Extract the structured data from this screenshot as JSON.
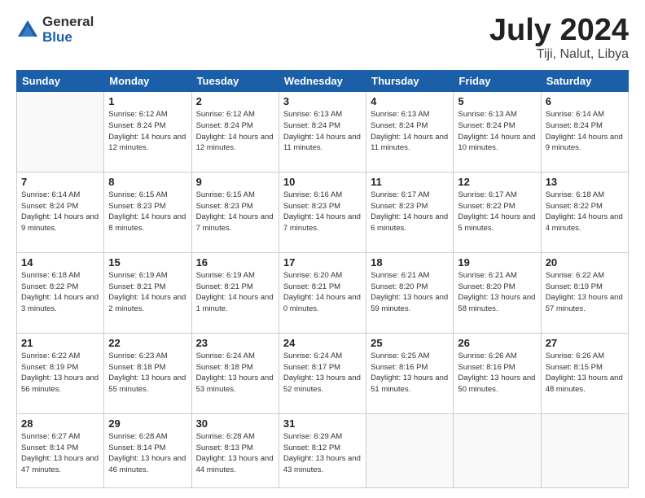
{
  "header": {
    "logo_general": "General",
    "logo_blue": "Blue",
    "title": "July 2024",
    "location": "Tiji, Nalut, Libya"
  },
  "days_of_week": [
    "Sunday",
    "Monday",
    "Tuesday",
    "Wednesday",
    "Thursday",
    "Friday",
    "Saturday"
  ],
  "weeks": [
    [
      {
        "day": "",
        "info": ""
      },
      {
        "day": "1",
        "info": "Sunrise: 6:12 AM\nSunset: 8:24 PM\nDaylight: 14 hours\nand 12 minutes."
      },
      {
        "day": "2",
        "info": "Sunrise: 6:12 AM\nSunset: 8:24 PM\nDaylight: 14 hours\nand 12 minutes."
      },
      {
        "day": "3",
        "info": "Sunrise: 6:13 AM\nSunset: 8:24 PM\nDaylight: 14 hours\nand 11 minutes."
      },
      {
        "day": "4",
        "info": "Sunrise: 6:13 AM\nSunset: 8:24 PM\nDaylight: 14 hours\nand 11 minutes."
      },
      {
        "day": "5",
        "info": "Sunrise: 6:13 AM\nSunset: 8:24 PM\nDaylight: 14 hours\nand 10 minutes."
      },
      {
        "day": "6",
        "info": "Sunrise: 6:14 AM\nSunset: 8:24 PM\nDaylight: 14 hours\nand 9 minutes."
      }
    ],
    [
      {
        "day": "7",
        "info": "Sunrise: 6:14 AM\nSunset: 8:24 PM\nDaylight: 14 hours\nand 9 minutes."
      },
      {
        "day": "8",
        "info": "Sunrise: 6:15 AM\nSunset: 8:23 PM\nDaylight: 14 hours\nand 8 minutes."
      },
      {
        "day": "9",
        "info": "Sunrise: 6:15 AM\nSunset: 8:23 PM\nDaylight: 14 hours\nand 7 minutes."
      },
      {
        "day": "10",
        "info": "Sunrise: 6:16 AM\nSunset: 8:23 PM\nDaylight: 14 hours\nand 7 minutes."
      },
      {
        "day": "11",
        "info": "Sunrise: 6:17 AM\nSunset: 8:23 PM\nDaylight: 14 hours\nand 6 minutes."
      },
      {
        "day": "12",
        "info": "Sunrise: 6:17 AM\nSunset: 8:22 PM\nDaylight: 14 hours\nand 5 minutes."
      },
      {
        "day": "13",
        "info": "Sunrise: 6:18 AM\nSunset: 8:22 PM\nDaylight: 14 hours\nand 4 minutes."
      }
    ],
    [
      {
        "day": "14",
        "info": "Sunrise: 6:18 AM\nSunset: 8:22 PM\nDaylight: 14 hours\nand 3 minutes."
      },
      {
        "day": "15",
        "info": "Sunrise: 6:19 AM\nSunset: 8:21 PM\nDaylight: 14 hours\nand 2 minutes."
      },
      {
        "day": "16",
        "info": "Sunrise: 6:19 AM\nSunset: 8:21 PM\nDaylight: 14 hours\nand 1 minute."
      },
      {
        "day": "17",
        "info": "Sunrise: 6:20 AM\nSunset: 8:21 PM\nDaylight: 14 hours\nand 0 minutes."
      },
      {
        "day": "18",
        "info": "Sunrise: 6:21 AM\nSunset: 8:20 PM\nDaylight: 13 hours\nand 59 minutes."
      },
      {
        "day": "19",
        "info": "Sunrise: 6:21 AM\nSunset: 8:20 PM\nDaylight: 13 hours\nand 58 minutes."
      },
      {
        "day": "20",
        "info": "Sunrise: 6:22 AM\nSunset: 8:19 PM\nDaylight: 13 hours\nand 57 minutes."
      }
    ],
    [
      {
        "day": "21",
        "info": "Sunrise: 6:22 AM\nSunset: 8:19 PM\nDaylight: 13 hours\nand 56 minutes."
      },
      {
        "day": "22",
        "info": "Sunrise: 6:23 AM\nSunset: 8:18 PM\nDaylight: 13 hours\nand 55 minutes."
      },
      {
        "day": "23",
        "info": "Sunrise: 6:24 AM\nSunset: 8:18 PM\nDaylight: 13 hours\nand 53 minutes."
      },
      {
        "day": "24",
        "info": "Sunrise: 6:24 AM\nSunset: 8:17 PM\nDaylight: 13 hours\nand 52 minutes."
      },
      {
        "day": "25",
        "info": "Sunrise: 6:25 AM\nSunset: 8:16 PM\nDaylight: 13 hours\nand 51 minutes."
      },
      {
        "day": "26",
        "info": "Sunrise: 6:26 AM\nSunset: 8:16 PM\nDaylight: 13 hours\nand 50 minutes."
      },
      {
        "day": "27",
        "info": "Sunrise: 6:26 AM\nSunset: 8:15 PM\nDaylight: 13 hours\nand 48 minutes."
      }
    ],
    [
      {
        "day": "28",
        "info": "Sunrise: 6:27 AM\nSunset: 8:14 PM\nDaylight: 13 hours\nand 47 minutes."
      },
      {
        "day": "29",
        "info": "Sunrise: 6:28 AM\nSunset: 8:14 PM\nDaylight: 13 hours\nand 46 minutes."
      },
      {
        "day": "30",
        "info": "Sunrise: 6:28 AM\nSunset: 8:13 PM\nDaylight: 13 hours\nand 44 minutes."
      },
      {
        "day": "31",
        "info": "Sunrise: 6:29 AM\nSunset: 8:12 PM\nDaylight: 13 hours\nand 43 minutes."
      },
      {
        "day": "",
        "info": ""
      },
      {
        "day": "",
        "info": ""
      },
      {
        "day": "",
        "info": ""
      }
    ]
  ]
}
